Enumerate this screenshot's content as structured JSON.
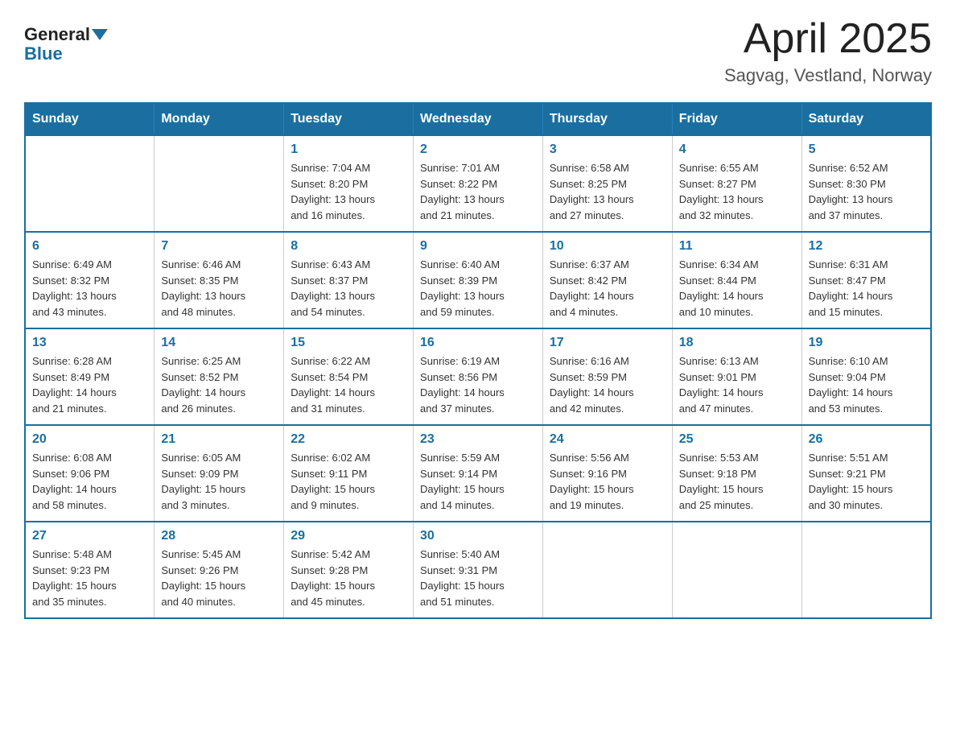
{
  "header": {
    "logo": {
      "general": "General",
      "blue": "Blue"
    },
    "title": "April 2025",
    "location": "Sagvag, Vestland, Norway"
  },
  "calendar": {
    "days_of_week": [
      "Sunday",
      "Monday",
      "Tuesday",
      "Wednesday",
      "Thursday",
      "Friday",
      "Saturday"
    ],
    "weeks": [
      [
        {
          "day": "",
          "info": ""
        },
        {
          "day": "",
          "info": ""
        },
        {
          "day": "1",
          "info": "Sunrise: 7:04 AM\nSunset: 8:20 PM\nDaylight: 13 hours\nand 16 minutes."
        },
        {
          "day": "2",
          "info": "Sunrise: 7:01 AM\nSunset: 8:22 PM\nDaylight: 13 hours\nand 21 minutes."
        },
        {
          "day": "3",
          "info": "Sunrise: 6:58 AM\nSunset: 8:25 PM\nDaylight: 13 hours\nand 27 minutes."
        },
        {
          "day": "4",
          "info": "Sunrise: 6:55 AM\nSunset: 8:27 PM\nDaylight: 13 hours\nand 32 minutes."
        },
        {
          "day": "5",
          "info": "Sunrise: 6:52 AM\nSunset: 8:30 PM\nDaylight: 13 hours\nand 37 minutes."
        }
      ],
      [
        {
          "day": "6",
          "info": "Sunrise: 6:49 AM\nSunset: 8:32 PM\nDaylight: 13 hours\nand 43 minutes."
        },
        {
          "day": "7",
          "info": "Sunrise: 6:46 AM\nSunset: 8:35 PM\nDaylight: 13 hours\nand 48 minutes."
        },
        {
          "day": "8",
          "info": "Sunrise: 6:43 AM\nSunset: 8:37 PM\nDaylight: 13 hours\nand 54 minutes."
        },
        {
          "day": "9",
          "info": "Sunrise: 6:40 AM\nSunset: 8:39 PM\nDaylight: 13 hours\nand 59 minutes."
        },
        {
          "day": "10",
          "info": "Sunrise: 6:37 AM\nSunset: 8:42 PM\nDaylight: 14 hours\nand 4 minutes."
        },
        {
          "day": "11",
          "info": "Sunrise: 6:34 AM\nSunset: 8:44 PM\nDaylight: 14 hours\nand 10 minutes."
        },
        {
          "day": "12",
          "info": "Sunrise: 6:31 AM\nSunset: 8:47 PM\nDaylight: 14 hours\nand 15 minutes."
        }
      ],
      [
        {
          "day": "13",
          "info": "Sunrise: 6:28 AM\nSunset: 8:49 PM\nDaylight: 14 hours\nand 21 minutes."
        },
        {
          "day": "14",
          "info": "Sunrise: 6:25 AM\nSunset: 8:52 PM\nDaylight: 14 hours\nand 26 minutes."
        },
        {
          "day": "15",
          "info": "Sunrise: 6:22 AM\nSunset: 8:54 PM\nDaylight: 14 hours\nand 31 minutes."
        },
        {
          "day": "16",
          "info": "Sunrise: 6:19 AM\nSunset: 8:56 PM\nDaylight: 14 hours\nand 37 minutes."
        },
        {
          "day": "17",
          "info": "Sunrise: 6:16 AM\nSunset: 8:59 PM\nDaylight: 14 hours\nand 42 minutes."
        },
        {
          "day": "18",
          "info": "Sunrise: 6:13 AM\nSunset: 9:01 PM\nDaylight: 14 hours\nand 47 minutes."
        },
        {
          "day": "19",
          "info": "Sunrise: 6:10 AM\nSunset: 9:04 PM\nDaylight: 14 hours\nand 53 minutes."
        }
      ],
      [
        {
          "day": "20",
          "info": "Sunrise: 6:08 AM\nSunset: 9:06 PM\nDaylight: 14 hours\nand 58 minutes."
        },
        {
          "day": "21",
          "info": "Sunrise: 6:05 AM\nSunset: 9:09 PM\nDaylight: 15 hours\nand 3 minutes."
        },
        {
          "day": "22",
          "info": "Sunrise: 6:02 AM\nSunset: 9:11 PM\nDaylight: 15 hours\nand 9 minutes."
        },
        {
          "day": "23",
          "info": "Sunrise: 5:59 AM\nSunset: 9:14 PM\nDaylight: 15 hours\nand 14 minutes."
        },
        {
          "day": "24",
          "info": "Sunrise: 5:56 AM\nSunset: 9:16 PM\nDaylight: 15 hours\nand 19 minutes."
        },
        {
          "day": "25",
          "info": "Sunrise: 5:53 AM\nSunset: 9:18 PM\nDaylight: 15 hours\nand 25 minutes."
        },
        {
          "day": "26",
          "info": "Sunrise: 5:51 AM\nSunset: 9:21 PM\nDaylight: 15 hours\nand 30 minutes."
        }
      ],
      [
        {
          "day": "27",
          "info": "Sunrise: 5:48 AM\nSunset: 9:23 PM\nDaylight: 15 hours\nand 35 minutes."
        },
        {
          "day": "28",
          "info": "Sunrise: 5:45 AM\nSunset: 9:26 PM\nDaylight: 15 hours\nand 40 minutes."
        },
        {
          "day": "29",
          "info": "Sunrise: 5:42 AM\nSunset: 9:28 PM\nDaylight: 15 hours\nand 45 minutes."
        },
        {
          "day": "30",
          "info": "Sunrise: 5:40 AM\nSunset: 9:31 PM\nDaylight: 15 hours\nand 51 minutes."
        },
        {
          "day": "",
          "info": ""
        },
        {
          "day": "",
          "info": ""
        },
        {
          "day": "",
          "info": ""
        }
      ]
    ]
  }
}
